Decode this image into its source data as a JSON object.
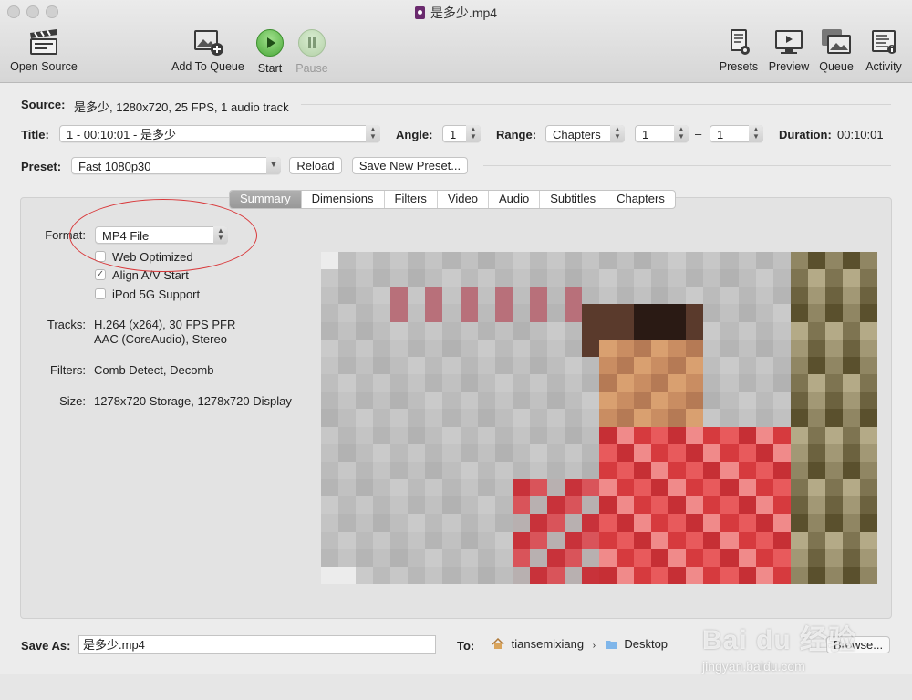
{
  "window": {
    "title": "是多少.mp4"
  },
  "toolbar": {
    "open_source": "Open Source",
    "add_to_queue": "Add To Queue",
    "start": "Start",
    "pause": "Pause",
    "presets": "Presets",
    "preview": "Preview",
    "queue": "Queue",
    "activity": "Activity"
  },
  "source": {
    "label": "Source:",
    "value": "是多少, 1280x720, 25 FPS, 1 audio track"
  },
  "title_row": {
    "label": "Title:",
    "value": "1 - 00:10:01 - 是多少",
    "angle_label": "Angle:",
    "angle": "1",
    "range_label": "Range:",
    "range_type": "Chapters",
    "range_from": "1",
    "range_dash": "–",
    "range_to": "1",
    "duration_label": "Duration:",
    "duration": "00:10:01"
  },
  "preset_row": {
    "label": "Preset:",
    "value": "Fast 1080p30",
    "reload": "Reload",
    "save_new": "Save New Preset..."
  },
  "tabs": [
    "Summary",
    "Dimensions",
    "Filters",
    "Video",
    "Audio",
    "Subtitles",
    "Chapters"
  ],
  "summary": {
    "format_label": "Format:",
    "format": "MP4 File",
    "web_optimized": "Web Optimized",
    "web_optimized_checked": false,
    "align_av": "Align A/V Start",
    "align_av_checked": true,
    "ipod": "iPod 5G Support",
    "ipod_checked": false,
    "tracks_label": "Tracks:",
    "tracks_1": "H.264 (x264), 30 FPS PFR",
    "tracks_2": "AAC (CoreAudio), Stereo",
    "filters_label": "Filters:",
    "filters": "Comb Detect, Decomb",
    "size_label": "Size:",
    "size": "1278x720 Storage, 1278x720 Display"
  },
  "save": {
    "label": "Save As:",
    "filename": "是多少.mp4",
    "to_label": "To:",
    "user": "tiansemixiang",
    "folder": "Desktop",
    "browse": "Browse..."
  },
  "watermark": {
    "brand": "Bai du 经验",
    "url": "jingyan.baidu.com"
  }
}
